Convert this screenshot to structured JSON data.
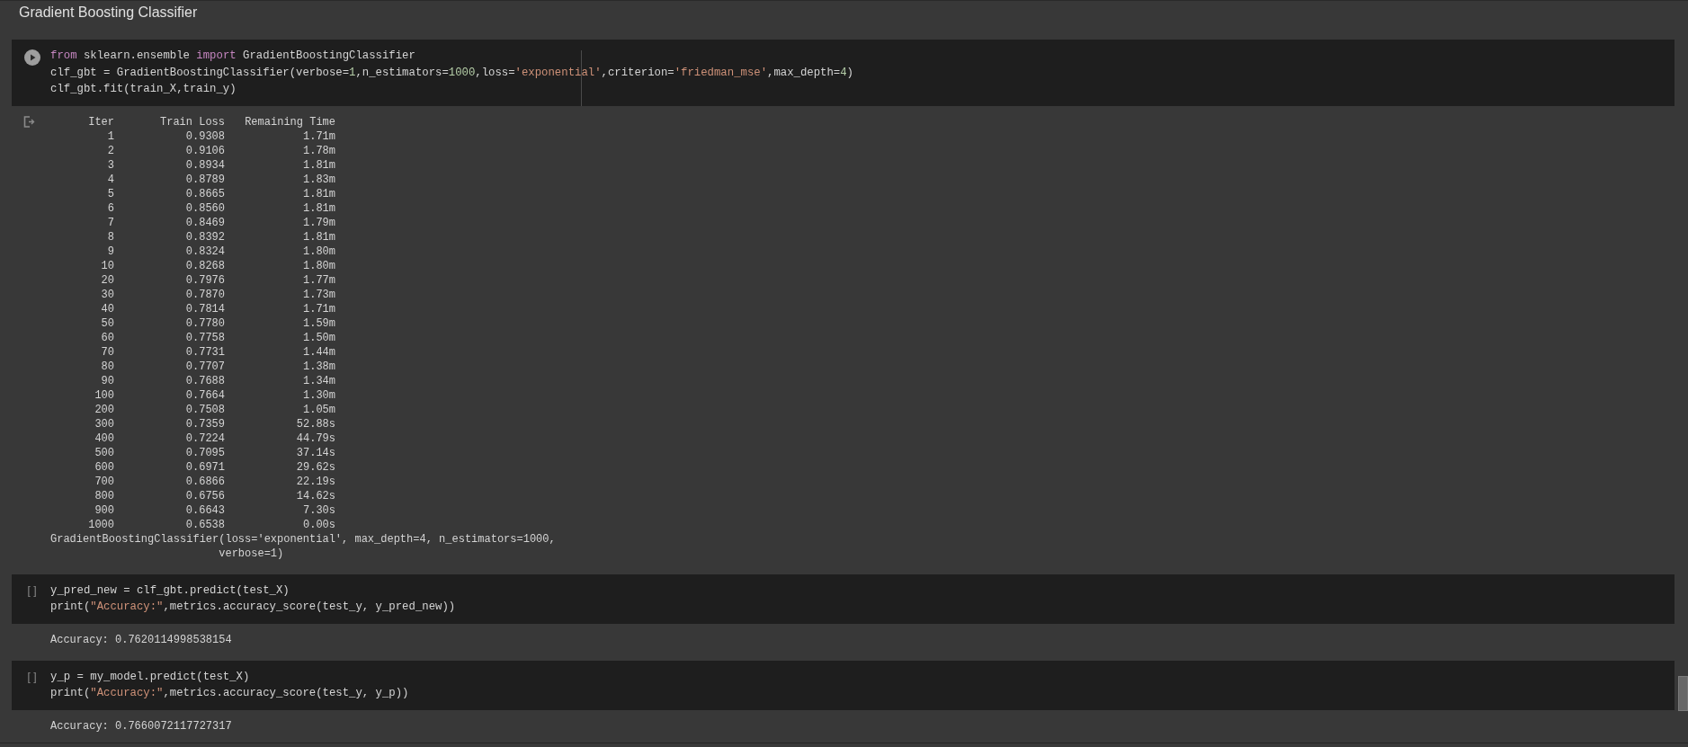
{
  "section_title": "Gradient Boosting Classifier",
  "cells": [
    {
      "prompt": {
        "kind": "run"
      },
      "code": [
        [
          {
            "kind": "keyword",
            "t": "from"
          },
          {
            "kind": "plain",
            "t": " sklearn.ensemble "
          },
          {
            "kind": "keyword",
            "t": "import"
          },
          {
            "kind": "plain",
            "t": " GradientBoostingClassifier"
          }
        ],
        [
          {
            "kind": "plain",
            "t": "clf_gbt = GradientBoostingClassifier(verbose="
          },
          {
            "kind": "number",
            "t": "1"
          },
          {
            "kind": "plain",
            "t": ",n_estimators="
          },
          {
            "kind": "number",
            "t": "1000"
          },
          {
            "kind": "plain",
            "t": ",loss="
          },
          {
            "kind": "string",
            "t": "'exponential'"
          },
          {
            "kind": "plain",
            "t": ",criterion="
          },
          {
            "kind": "string",
            "t": "'friedman_mse'"
          },
          {
            "kind": "plain",
            "t": ",max_depth="
          },
          {
            "kind": "number",
            "t": "4"
          },
          {
            "kind": "plain",
            "t": ")"
          }
        ],
        [
          {
            "kind": "plain",
            "t": "clf_gbt.fit(train_X,train_y)"
          }
        ]
      ],
      "output": {
        "icon": true,
        "table": {
          "columns": [
            "Iter",
            "Train Loss",
            "Remaining Time"
          ],
          "rows": [
            [
              "1",
              "0.9308",
              "1.71m"
            ],
            [
              "2",
              "0.9106",
              "1.78m"
            ],
            [
              "3",
              "0.8934",
              "1.81m"
            ],
            [
              "4",
              "0.8789",
              "1.83m"
            ],
            [
              "5",
              "0.8665",
              "1.81m"
            ],
            [
              "6",
              "0.8560",
              "1.81m"
            ],
            [
              "7",
              "0.8469",
              "1.79m"
            ],
            [
              "8",
              "0.8392",
              "1.81m"
            ],
            [
              "9",
              "0.8324",
              "1.80m"
            ],
            [
              "10",
              "0.8268",
              "1.80m"
            ],
            [
              "20",
              "0.7976",
              "1.77m"
            ],
            [
              "30",
              "0.7870",
              "1.73m"
            ],
            [
              "40",
              "0.7814",
              "1.71m"
            ],
            [
              "50",
              "0.7780",
              "1.59m"
            ],
            [
              "60",
              "0.7758",
              "1.50m"
            ],
            [
              "70",
              "0.7731",
              "1.44m"
            ],
            [
              "80",
              "0.7707",
              "1.38m"
            ],
            [
              "90",
              "0.7688",
              "1.34m"
            ],
            [
              "100",
              "0.7664",
              "1.30m"
            ],
            [
              "200",
              "0.7508",
              "1.05m"
            ],
            [
              "300",
              "0.7359",
              "52.88s"
            ],
            [
              "400",
              "0.7224",
              "44.79s"
            ],
            [
              "500",
              "0.7095",
              "37.14s"
            ],
            [
              "600",
              "0.6971",
              "29.62s"
            ],
            [
              "700",
              "0.6866",
              "22.19s"
            ],
            [
              "800",
              "0.6756",
              "14.62s"
            ],
            [
              "900",
              "0.6643",
              "7.30s"
            ],
            [
              "1000",
              "0.6538",
              "0.00s"
            ]
          ]
        },
        "text": "GradientBoostingClassifier(loss='exponential', max_depth=4, n_estimators=1000,\n                          verbose=1)"
      }
    },
    {
      "prompt": {
        "kind": "brackets",
        "text": "[ ]"
      },
      "code": [
        [
          {
            "kind": "plain",
            "t": "y_pred_new = clf_gbt.predict(test_X)"
          }
        ],
        [
          {
            "kind": "plain",
            "t": "print("
          },
          {
            "kind": "string",
            "t": "\"Accuracy:\""
          },
          {
            "kind": "plain",
            "t": ",metrics.accuracy_score(test_y, y_pred_new))"
          }
        ]
      ],
      "output": {
        "icon": false,
        "text": "Accuracy: 0.7620114998538154"
      }
    },
    {
      "prompt": {
        "kind": "brackets",
        "text": "[ ]"
      },
      "code": [
        [
          {
            "kind": "plain",
            "t": "y_p = my_model.predict(test_X)"
          }
        ],
        [
          {
            "kind": "plain",
            "t": "print("
          },
          {
            "kind": "string",
            "t": "\"Accuracy:\""
          },
          {
            "kind": "plain",
            "t": ",metrics.accuracy_score(test_y, y_p))"
          }
        ]
      ],
      "output": {
        "icon": false,
        "text": "Accuracy: 0.7660072117727317"
      }
    }
  ]
}
